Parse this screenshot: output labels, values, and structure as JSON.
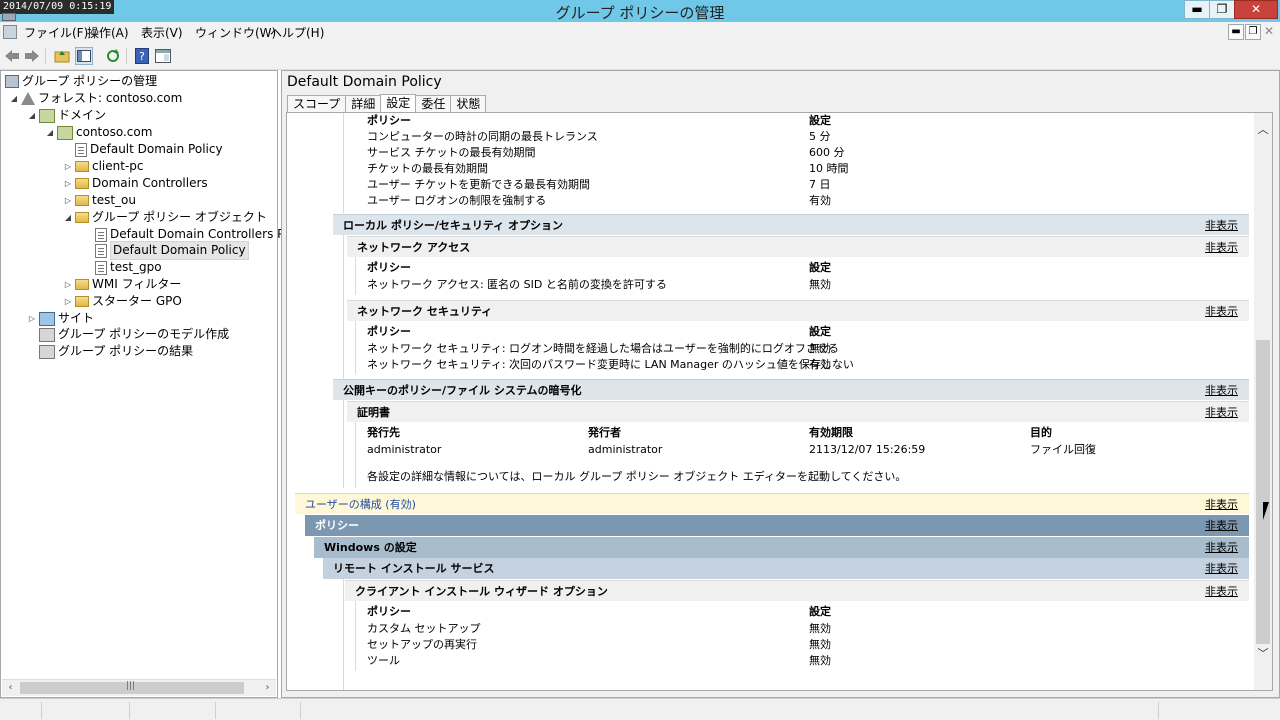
{
  "window": {
    "title": "グループ ポリシーの管理",
    "clock": "2014/07/09 0:15:19",
    "minimize": "▬",
    "restore": "❐",
    "close": "✕"
  },
  "menu": {
    "file": "ファイル(F)",
    "action": "操作(A)",
    "view": "表示(V)",
    "window": "ウィンドウ(W)",
    "help": "ヘルプ(H)",
    "mdi_min": "▬",
    "mdi_restore": "❐"
  },
  "tree": {
    "root": "グループ ポリシーの管理",
    "forest": "フォレスト: contoso.com",
    "domains": "ドメイン",
    "domain": "contoso.com",
    "ddp_link": "Default Domain Policy",
    "client_pc": "client-pc",
    "dc": "Domain Controllers",
    "test_ou": "test_ou",
    "gpo_folder": "グループ ポリシー オブジェクト",
    "gpo_ddcp": "Default Domain Controllers Po",
    "gpo_ddp": "Default Domain Policy",
    "gpo_test": "test_gpo",
    "wmi": "WMI フィルター",
    "starter": "スターター GPO",
    "sites": "サイト",
    "modeling": "グループ ポリシーのモデル作成",
    "results": "グループ ポリシーの結果"
  },
  "right": {
    "title": "Default Domain Policy",
    "tabs": [
      "スコープ",
      "詳細",
      "設定",
      "委任",
      "状態"
    ]
  },
  "report": {
    "hide": "非表示",
    "col_policy": "ポリシー",
    "col_setting": "設定",
    "kerberos": [
      {
        "name": "コンピューターの時計の同期の最長トレランス",
        "value": "5 分"
      },
      {
        "name": "サービス チケットの最長有効期間",
        "value": "600 分"
      },
      {
        "name": "チケットの最長有効期間",
        "value": "10 時間"
      },
      {
        "name": "ユーザー チケットを更新できる最長有効期間",
        "value": "7 日"
      },
      {
        "name": "ユーザー ログオンの制限を強制する",
        "value": "有効"
      }
    ],
    "local_sec": "ローカル ポリシー/セキュリティ オプション",
    "net_access": "ネットワーク アクセス",
    "net_access_rows": [
      {
        "name": "ネットワーク アクセス: 匿名の SID と名前の変換を許可する",
        "value": "無効"
      }
    ],
    "net_security": "ネットワーク セキュリティ",
    "net_security_rows": [
      {
        "name": "ネットワーク セキュリティ: ログオン時間を経過した場合はユーザーを強制的にログオフさせる",
        "value": "無効"
      },
      {
        "name": "ネットワーク セキュリティ: 次回のパスワード変更時に LAN Manager のハッシュ値を保存しない",
        "value": "有効"
      }
    ],
    "pubkey": "公開キーのポリシー/ファイル システムの暗号化",
    "cert": "証明書",
    "cert_headers": [
      "発行先",
      "発行者",
      "有効期限",
      "目的"
    ],
    "cert_row": [
      "administrator",
      "administrator",
      "2113/12/07 15:26:59",
      "ファイル回復"
    ],
    "note": "各設定の詳細な情報については、ローカル グループ ポリシー オブジェクト エディターを起動してください。",
    "user_config": "ユーザーの構成 (有効)",
    "policies": "ポリシー",
    "windows_settings": "Windows の設定",
    "ris": "リモート インストール サービス",
    "ris_wizard": "クライアント インストール ウィザード オプション",
    "ris_rows": [
      {
        "name": "カスタム セットアップ",
        "value": "無効"
      },
      {
        "name": "セットアップの再実行",
        "value": "無効"
      },
      {
        "name": "ツール",
        "value": "無効"
      }
    ]
  },
  "colors": {
    "titlebar": "#6fc8e8",
    "policies_bar": "#7c98b0",
    "windows_bar": "#a7bccc",
    "ris_bar": "#c3d2de",
    "user_config_bg": "#fff8d8",
    "user_config_text": "#1f4da1"
  }
}
